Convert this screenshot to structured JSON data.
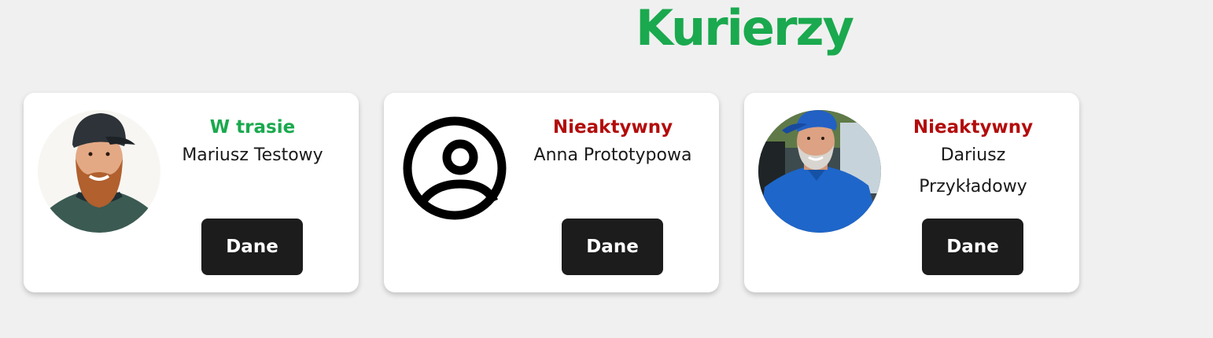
{
  "header": {
    "title": "Kurierzy"
  },
  "colors": {
    "title": "#1aa94e",
    "status_active": "#1aa94e",
    "status_inactive": "#b30c0c",
    "button_bg": "#1c1c1c",
    "page_bg": "#f0f0f0",
    "card_bg": "#ffffff"
  },
  "couriers": [
    {
      "status": "W trasie",
      "status_kind": "active",
      "name": "Mariusz Testowy",
      "avatar": "photo-bearded-man-cap",
      "button_label": "Dane"
    },
    {
      "status": "Nieaktywny",
      "status_kind": "inactive",
      "name": "Anna Prototypowa",
      "avatar": "user-circle-icon",
      "button_label": "Dane"
    },
    {
      "status": "Nieaktywny",
      "status_kind": "inactive",
      "name": "Dariusz Przykładowy",
      "avatar": "photo-older-man-cap",
      "button_label": "Dane"
    }
  ]
}
